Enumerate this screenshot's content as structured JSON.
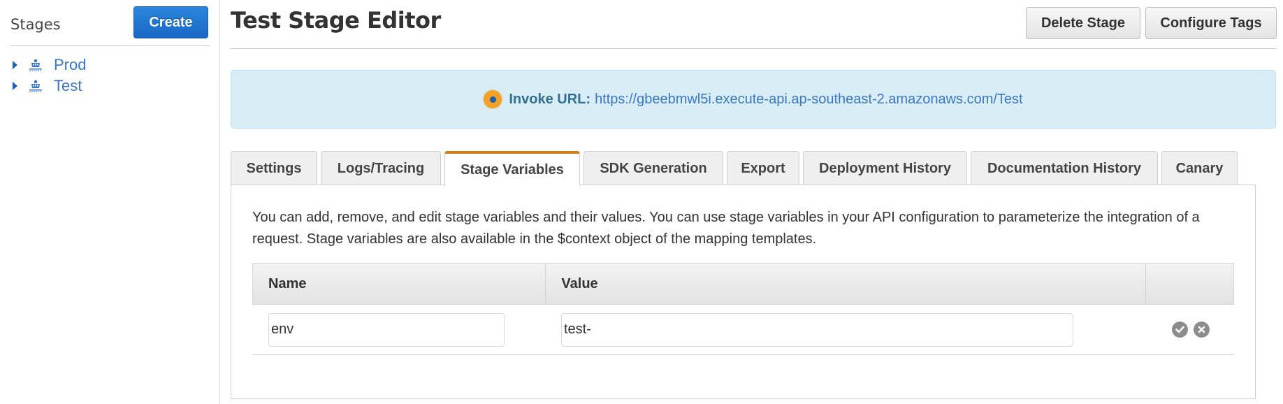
{
  "sidebar": {
    "title": "Stages",
    "create_label": "Create",
    "stages": [
      {
        "label": "Prod",
        "icon": "stage-ship-icon",
        "expanded": false
      },
      {
        "label": "Test",
        "icon": "stage-ship-icon",
        "expanded": false
      }
    ]
  },
  "header": {
    "title": "Test Stage Editor",
    "delete_label": "Delete Stage",
    "tags_label": "Configure Tags"
  },
  "invoke": {
    "icon": "target-icon",
    "label": "Invoke URL:",
    "url": "https://gbeebmwl5i.execute-api.ap-southeast-2.amazonaws.com/Test"
  },
  "tabs": [
    {
      "label": "Settings",
      "active": false
    },
    {
      "label": "Logs/Tracing",
      "active": false
    },
    {
      "label": "Stage Variables",
      "active": true
    },
    {
      "label": "SDK Generation",
      "active": false
    },
    {
      "label": "Export",
      "active": false
    },
    {
      "label": "Deployment History",
      "active": false
    },
    {
      "label": "Documentation History",
      "active": false
    },
    {
      "label": "Canary",
      "active": false
    }
  ],
  "stage_variables": {
    "description": "You can add, remove, and edit stage variables and their values. You can use stage variables in your API configuration to parameterize the integration of a request. Stage variables are also available in the $context object of the mapping templates.",
    "columns": [
      "Name",
      "Value",
      ""
    ],
    "rows": [
      {
        "name": "env",
        "value": "test-",
        "actions": [
          "confirm-check-icon",
          "cancel-x-icon"
        ]
      }
    ]
  },
  "colors": {
    "primary_button": "#1867c4",
    "link": "#3a77c2",
    "active_tab_accent": "#d17f1e",
    "info_banner_bg": "#d9edf7",
    "info_label": "#31708f"
  }
}
